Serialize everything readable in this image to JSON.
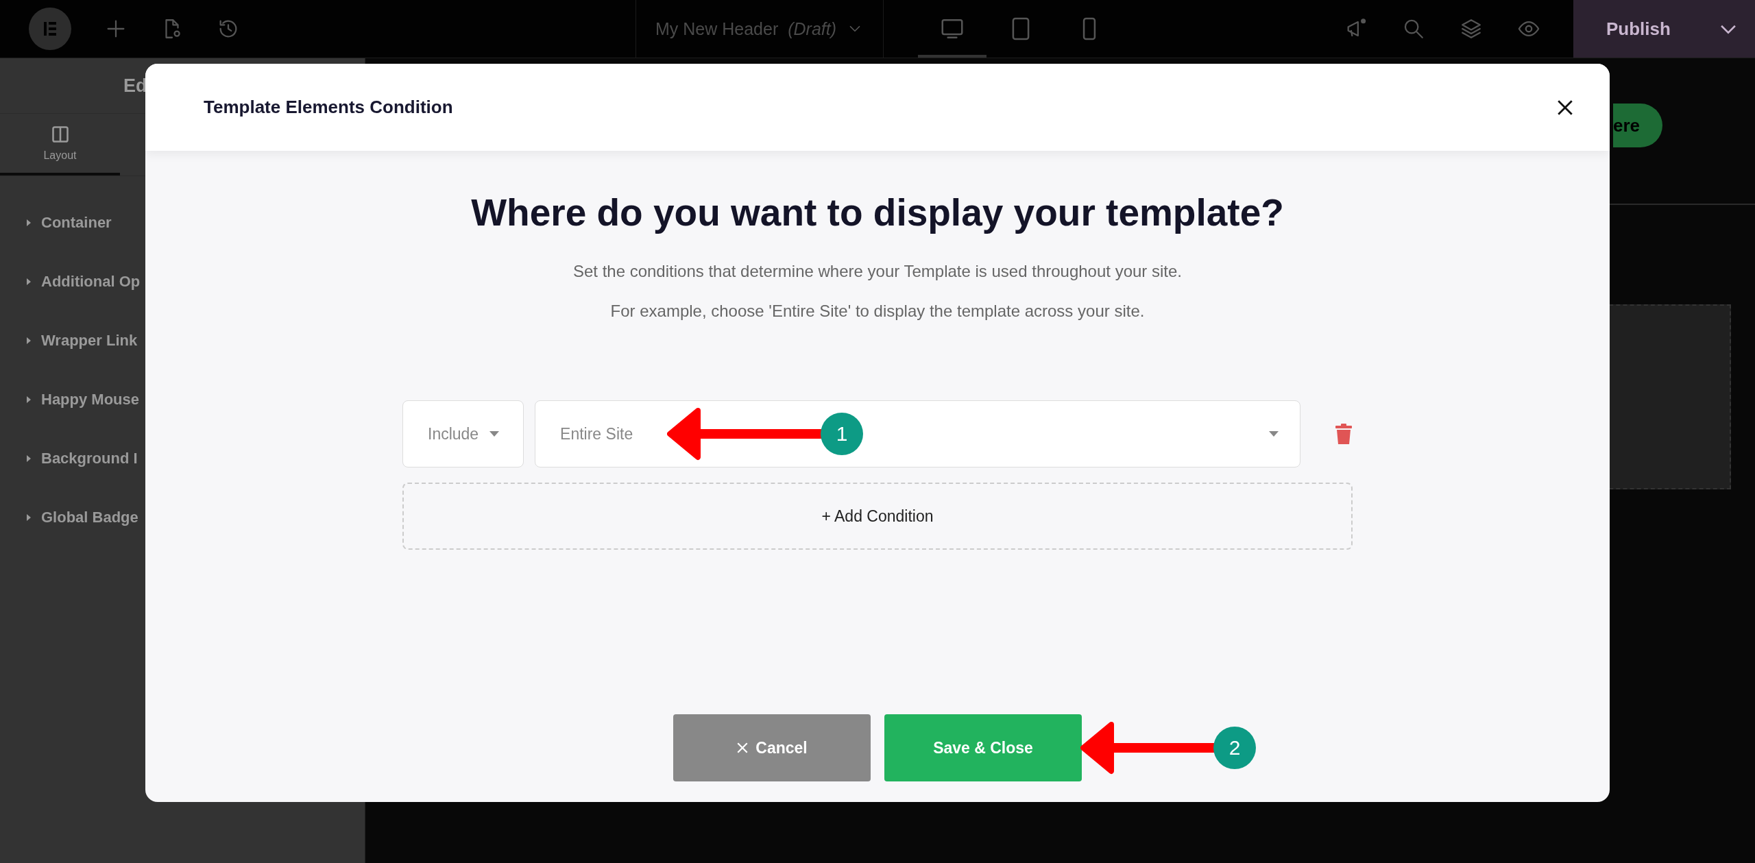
{
  "topbar": {
    "document_title": "My New Header",
    "document_status": "(Draft)",
    "devices": [
      {
        "kind": "desktop",
        "selected": true
      },
      {
        "kind": "tablet",
        "selected": false
      },
      {
        "kind": "mobile",
        "selected": false
      }
    ],
    "publish_button": "Publish"
  },
  "panel": {
    "heading": "Ed",
    "tabs": [
      {
        "label": "Layout",
        "selected": true
      }
    ],
    "sections": [
      "Container",
      "Additional Op",
      "Wrapper Link",
      "Happy Mouse",
      "Background I",
      "Global Badge"
    ]
  },
  "canvas": {
    "button_text": "ere"
  },
  "modal": {
    "title": "Template Elements Condition",
    "heading": "Where do you want to display your template?",
    "description": [
      "Set the conditions that determine where your Template is used throughout your site.",
      "For example, choose 'Entire Site' to display the template across your site."
    ],
    "conditions": [
      {
        "type": "Include",
        "value": "Entire Site"
      }
    ],
    "add_button": "+ Add Condition",
    "cancel_button": "Cancel",
    "save_button": "Save & Close"
  },
  "annotations": [
    {
      "label": "1"
    },
    {
      "label": "2"
    }
  ]
}
